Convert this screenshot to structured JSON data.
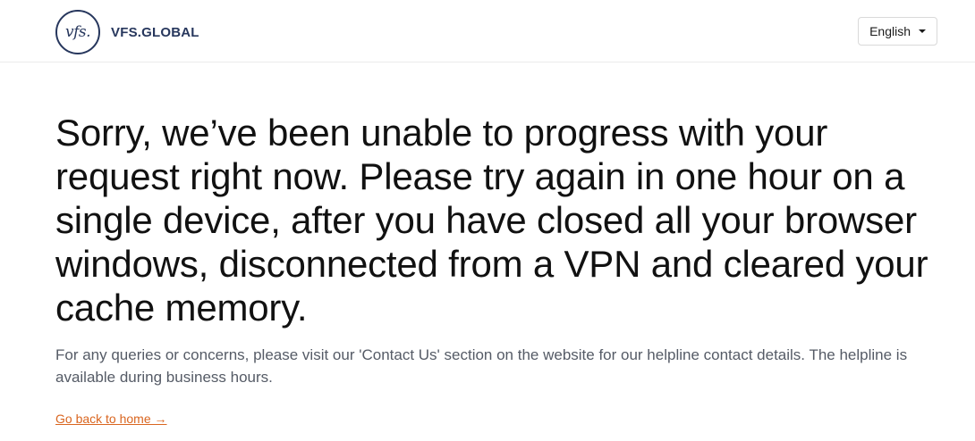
{
  "header": {
    "logo_mark": "vfs.",
    "logo_text": "VFS.GLOBAL",
    "language_label": "English"
  },
  "main": {
    "headline": "Sorry, we’ve been unable to progress with your request right now. Please try again in one hour on a single device, after you have closed all your browser windows, disconnected from a VPN and cleared your cache memory.",
    "subtext": "For any queries or concerns, please visit our 'Contact Us' section on the website for our helpline contact details. The helpline is available during business hours.",
    "home_link": "Go back to home →"
  },
  "colors": {
    "brand": "#27375d",
    "link": "#d9651f",
    "subtext": "#555b66"
  }
}
